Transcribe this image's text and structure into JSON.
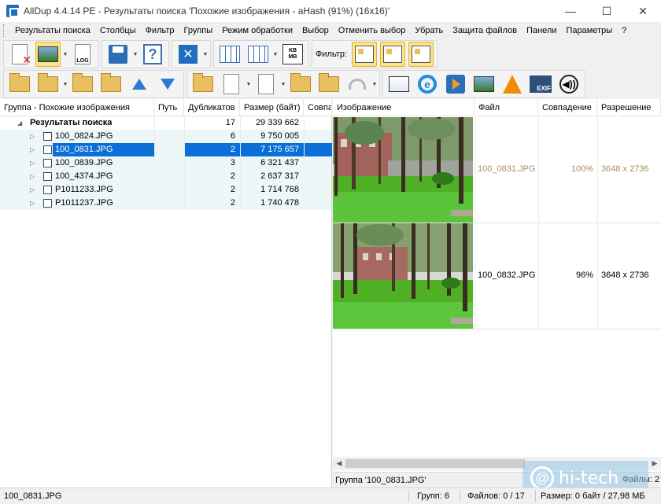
{
  "window": {
    "title": "AllDup 4.4.14 PE - Результаты поиска 'Похожие изображения - aHash (91%) (16x16)'",
    "minimize": "—",
    "maximize": "☐",
    "close": "✕"
  },
  "menu": {
    "items": [
      "Результаты поиска",
      "Столбцы",
      "Фильтр",
      "Группы",
      "Режим обработки",
      "Выбор",
      "Отменить выбор",
      "Убрать",
      "Защита файлов",
      "Панели",
      "Параметры",
      "?"
    ]
  },
  "toolbar": {
    "filter_label": "Фильтр:",
    "log_label": "LOG",
    "kb_label": "KB",
    "mb_label": "MB",
    "exif_label": "EXIF",
    "ie_label": "e",
    "sound_label": "◀))",
    "help_label": "?",
    "close_label": "✕"
  },
  "left_table": {
    "headers": [
      "Группа - Похожие изображения",
      "Путь",
      "Дубликатов",
      "Размер (байт)",
      "Совпа"
    ],
    "root": {
      "label": "Результаты поиска",
      "duplicates": "17",
      "size": "29 339 662"
    },
    "rows": [
      {
        "name": "100_0824.JPG",
        "duplicates": "6",
        "size": "9 750 005"
      },
      {
        "name": "100_0831.JPG",
        "duplicates": "2",
        "size": "7 175 657"
      },
      {
        "name": "100_0839.JPG",
        "duplicates": "3",
        "size": "6 321 437"
      },
      {
        "name": "100_4374.JPG",
        "duplicates": "2",
        "size": "2 637 317"
      },
      {
        "name": "P1011233.JPG",
        "duplicates": "2",
        "size": "1 714 768"
      },
      {
        "name": "P1011237.JPG",
        "duplicates": "2",
        "size": "1 740 478"
      }
    ]
  },
  "right_table": {
    "headers": [
      "Изображение",
      "Файл",
      "Совпадение",
      "Разрешение"
    ],
    "rows": [
      {
        "file": "100_0831.JPG",
        "match": "100%",
        "resolution": "3648 x 2736"
      },
      {
        "file": "100_0832.JPG",
        "match": "96%",
        "resolution": "3648 x 2736"
      }
    ],
    "group_caption": "Группа '100_0831.JPG'",
    "files_caption": "Файлы: 2",
    "scroll_left": "◀",
    "scroll_right": "▶"
  },
  "status": {
    "current_file": "100_0831.JPG",
    "groups": "Групп: 6",
    "files": "Файлов: 0 / 17",
    "size": "Размер: 0 байт / 27,98 МБ"
  },
  "watermark": {
    "symbol": "@",
    "text": "hi-tech"
  },
  "colors": {
    "selection": "#0a6fd6",
    "group_row": "#eef7f7",
    "toolbar_active": "#fbe38a"
  }
}
